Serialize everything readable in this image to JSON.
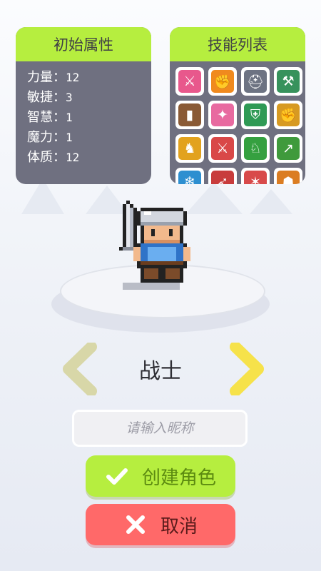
{
  "attributes_panel": {
    "title": "初始属性",
    "stats": [
      {
        "label": "力量：",
        "value": "12"
      },
      {
        "label": "敏捷：",
        "value": "3"
      },
      {
        "label": "智慧：",
        "value": "1"
      },
      {
        "label": "魔力：",
        "value": "1"
      },
      {
        "label": "体质：",
        "value": "12"
      }
    ]
  },
  "skills_panel": {
    "title": "技能列表",
    "skills": [
      {
        "icon": "sword-icon",
        "glyph": "⚔",
        "color": "#e8588c"
      },
      {
        "icon": "fist-icon",
        "glyph": "✊",
        "color": "#f08a1e"
      },
      {
        "icon": "helmet-icon",
        "glyph": "⛑",
        "color": "#6d7382"
      },
      {
        "icon": "axe-warrior-icon",
        "glyph": "⚒",
        "color": "#37925c"
      },
      {
        "icon": "boot-icon",
        "glyph": "▮",
        "color": "#8a5a35"
      },
      {
        "icon": "slash-icon",
        "glyph": "✦",
        "color": "#e86aa0"
      },
      {
        "icon": "shield-icon",
        "glyph": "⛨",
        "color": "#2f9a55"
      },
      {
        "icon": "strength-icon",
        "glyph": "✊",
        "color": "#d79a22"
      },
      {
        "icon": "knight-icon",
        "glyph": "♞",
        "color": "#e2a21e"
      },
      {
        "icon": "blade-icon",
        "glyph": "⚔",
        "color": "#d94848"
      },
      {
        "icon": "charge-icon",
        "glyph": "♘",
        "color": "#35a040"
      },
      {
        "icon": "spear-icon",
        "glyph": "↗",
        "color": "#3f9a3c"
      },
      {
        "icon": "frost-icon",
        "glyph": "❄",
        "color": "#2d8fd0"
      },
      {
        "icon": "spear-throw-icon",
        "glyph": "➶",
        "color": "#c83c3c"
      },
      {
        "icon": "claw-icon",
        "glyph": "✶",
        "color": "#d84a4a"
      },
      {
        "icon": "berserker-icon",
        "glyph": "☗",
        "color": "#db7d22"
      }
    ]
  },
  "character": {
    "class_name": "战士",
    "icon": "warrior-sprite-icon"
  },
  "nickname_input": {
    "value": "",
    "placeholder": "请输入昵称"
  },
  "buttons": {
    "create_label": "创建角色",
    "cancel_label": "取消"
  },
  "colors": {
    "accent_green": "#b6ee3f",
    "cancel_red": "#ff6969",
    "panel_gray": "#6f7080"
  }
}
